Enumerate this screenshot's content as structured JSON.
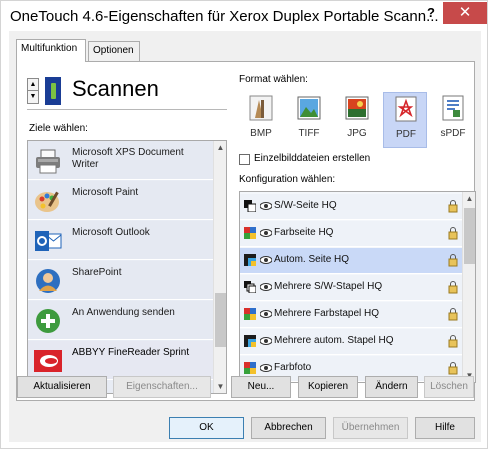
{
  "window": {
    "title": "OneTouch 4.6-Eigenschaften für Xerox Duplex Portable Scann...",
    "help_glyph": "?",
    "close_glyph": "✕"
  },
  "tabs": [
    {
      "label": "Multifunktion",
      "active": true
    },
    {
      "label": "Optionen",
      "active": false
    }
  ],
  "action": {
    "name": "Scannen",
    "spinner_up": "▲",
    "spinner_down": "▼"
  },
  "destinations": {
    "label": "Ziele wählen:",
    "items": [
      {
        "label": "Microsoft XPS Document Writer",
        "icon": "printer-icon",
        "selected": false
      },
      {
        "label": "Microsoft Paint",
        "icon": "paint-palette-icon",
        "selected": false
      },
      {
        "label": "Microsoft Outlook",
        "icon": "outlook-icon",
        "selected": false
      },
      {
        "label": "SharePoint",
        "icon": "sharepoint-icon",
        "selected": false
      },
      {
        "label": "An Anwendung senden",
        "icon": "send-to-application-icon",
        "selected": false
      },
      {
        "label": "ABBYY FineReader Sprint",
        "icon": "abbyy-icon",
        "selected": true
      }
    ],
    "scroll_up": "▲",
    "scroll_down": "▼"
  },
  "formats": {
    "label": "Format wählen:",
    "items": [
      {
        "label": "BMP",
        "icon": "bmp-icon",
        "selected": false
      },
      {
        "label": "TIFF",
        "icon": "tiff-icon",
        "selected": false
      },
      {
        "label": "JPG",
        "icon": "jpg-icon",
        "selected": false
      },
      {
        "label": "PDF",
        "icon": "pdf-icon",
        "selected": true
      },
      {
        "label": "sPDF",
        "icon": "spdf-icon",
        "selected": false
      }
    ],
    "single_files_label": "Einzelbilddateien erstellen",
    "single_files_checked": false
  },
  "configurations": {
    "label": "Konfiguration wählen:",
    "items": [
      {
        "label": "S/W-Seite HQ",
        "icon": "bw-page-icon",
        "selected": false
      },
      {
        "label": "Farbseite HQ",
        "icon": "color-page-icon",
        "selected": false
      },
      {
        "label": "Autom. Seite HQ",
        "icon": "auto-page-icon",
        "selected": true
      },
      {
        "label": "Mehrere S/W-Stapel HQ",
        "icon": "bw-stack-icon",
        "selected": false
      },
      {
        "label": "Mehrere Farbstapel HQ",
        "icon": "color-stack-icon",
        "selected": false
      },
      {
        "label": "Mehrere autom. Stapel HQ",
        "icon": "auto-stack-icon",
        "selected": false
      },
      {
        "label": "Farbfoto",
        "icon": "color-photo-icon",
        "selected": false
      }
    ],
    "scroll_up": "▲",
    "scroll_down": "▼"
  },
  "buttons": {
    "refresh": "Aktualisieren",
    "properties": "Eigenschaften...",
    "new": "Neu...",
    "copy": "Kopieren",
    "change": "Ändern",
    "delete": "Löschen",
    "ok": "OK",
    "cancel": "Abbrechen",
    "apply": "Übernehmen",
    "help": "Hilfe"
  },
  "colors": {
    "close_button": "#c74a4a",
    "selection": "#c9d9f7",
    "accent": "#1a3d95"
  }
}
